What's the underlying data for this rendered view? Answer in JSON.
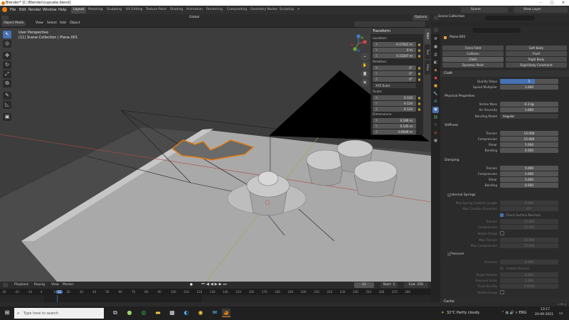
{
  "window": {
    "title": "Blender* [C:\\Blender\\cupcake.blend]",
    "min": "–",
    "max": "□",
    "close": "✕"
  },
  "menu": [
    "File",
    "Edit",
    "Render",
    "Window",
    "Help"
  ],
  "workspaces": [
    "Layout",
    "Modeling",
    "Sculpting",
    "UV Editing",
    "Texture Paint",
    "Shading",
    "Animation",
    "Rendering",
    "Compositing",
    "Geometry Nodes",
    "Scripting",
    "+"
  ],
  "scene": {
    "label": "Scene",
    "view_layer": "View Layer"
  },
  "viewport_header": {
    "mode": "Object Mode",
    "menus": [
      "View",
      "Select",
      "Add",
      "Object"
    ],
    "orientation": "Global",
    "options": "Options"
  },
  "viewport": {
    "view_name": "User Perspective",
    "collection": "(11) Scene Collection | Plane.001"
  },
  "npanel": {
    "header": "Transform",
    "location_label": "Location:",
    "location": [
      {
        "axis": "X",
        "value": "-0.17922 m"
      },
      {
        "axis": "Y",
        "value": "0 m"
      },
      {
        "axis": "Z",
        "value": "0.15207 m"
      }
    ],
    "rotation_label": "Rotation:",
    "rotation": [
      {
        "axis": "X",
        "value": "0°"
      },
      {
        "axis": "Y",
        "value": "0°"
      },
      {
        "axis": "Z",
        "value": "0°"
      }
    ],
    "rotation_mode": "XYZ Euler",
    "scale_label": "Scale:",
    "scale": [
      {
        "axis": "X",
        "value": "0.124"
      },
      {
        "axis": "Y",
        "value": "0.124"
      },
      {
        "axis": "Z",
        "value": "0.124"
      }
    ],
    "dimensions_label": "Dimensions:",
    "dimensions": [
      {
        "axis": "X",
        "value": "0.186 m"
      },
      {
        "axis": "Y",
        "value": "0.145 m"
      },
      {
        "axis": "Z",
        "value": "0.0648 m"
      }
    ],
    "tabs": [
      "Item",
      "Tool",
      "View"
    ]
  },
  "timeline": {
    "menus": [
      "Playback",
      "Keying",
      "View",
      "Marker"
    ],
    "current_frame": "11",
    "start_label": "Start",
    "start": "1",
    "end_label": "End",
    "end": "250",
    "ticks": [
      "-30",
      "-20",
      "-10",
      "0",
      "10",
      "11",
      "20",
      "30",
      "40",
      "50",
      "60",
      "70",
      "80",
      "90",
      "100",
      "110",
      "120",
      "130",
      "140",
      "150",
      "160",
      "170",
      "180",
      "190",
      "200",
      "210",
      "220",
      "230",
      "240",
      "250",
      "260",
      "270",
      "280"
    ]
  },
  "outliner": {
    "title": "Scene Collection"
  },
  "properties": {
    "object_name": "Plane.001",
    "physics_buttons": [
      [
        "Force Field",
        "Soft Body"
      ],
      [
        "Collision",
        "Fluid"
      ],
      [
        "Cloth",
        "Rigid Body"
      ],
      [
        "Dynamic Paint",
        "Rigid Body Constraint"
      ]
    ],
    "cloth": {
      "header": "Cloth",
      "quality_label": "Quality Steps",
      "quality": "5",
      "speed_label": "Speed Multiplier",
      "speed": "1.000",
      "physical_header": "Physical Properties",
      "mass_label": "Vertex Mass",
      "mass": "0.3 kg",
      "air_label": "Air Viscosity",
      "air": "1.000",
      "bending_model_label": "Bending Model",
      "bending_model": "Angular",
      "stiffness_header": "Stiffness",
      "stiffness": [
        {
          "label": "Tension",
          "value": "15.000"
        },
        {
          "label": "Compression",
          "value": "15.000"
        },
        {
          "label": "Shear",
          "value": "5.000"
        },
        {
          "label": "Bending",
          "value": "0.500"
        }
      ],
      "damping_header": "Damping",
      "damping": [
        {
          "label": "Tension",
          "value": "5.000"
        },
        {
          "label": "Compression",
          "value": "5.000"
        },
        {
          "label": "Shear",
          "value": "5.000"
        },
        {
          "label": "Bending",
          "value": "0.500"
        }
      ],
      "springs_header": "Internal Springs",
      "springs": [
        {
          "label": "Max Spring Creation Length",
          "value": "0.000"
        },
        {
          "label": "Max Creation Diversion",
          "value": "45°"
        }
      ],
      "check_normals": "Check Surface Normals",
      "springs2": [
        {
          "label": "Tension",
          "value": "15.000"
        },
        {
          "label": "Compression",
          "value": "15.000"
        }
      ],
      "vertex_group_label": "Vertex Group",
      "springs3": [
        {
          "label": "Max Tension",
          "value": "15.000"
        },
        {
          "label": "Max Compression",
          "value": "15.000"
        }
      ],
      "pressure_header": "Pressure",
      "pressure_label": "Pressure",
      "pressure": "0.000",
      "custom_volume": "Custom Volume",
      "pressure2": [
        {
          "label": "Target Volume",
          "value": "0.000"
        },
        {
          "label": "Pressure Scale",
          "value": "1.000"
        },
        {
          "label": "Fluid Density",
          "value": "0.0000"
        }
      ],
      "pressure_vg_label": "Vertex Group",
      "cache_header": "Cache"
    }
  },
  "status": {
    "version": "2.93.4"
  },
  "taskbar": {
    "search_placeholder": "Type here to search",
    "weather": "32°C  Partly cloudy",
    "time": "13:17",
    "date": "20-09-2021"
  },
  "colors": {
    "accent": "#4772b3",
    "selection": "#e87d0d",
    "header": "#2b2b2b"
  }
}
